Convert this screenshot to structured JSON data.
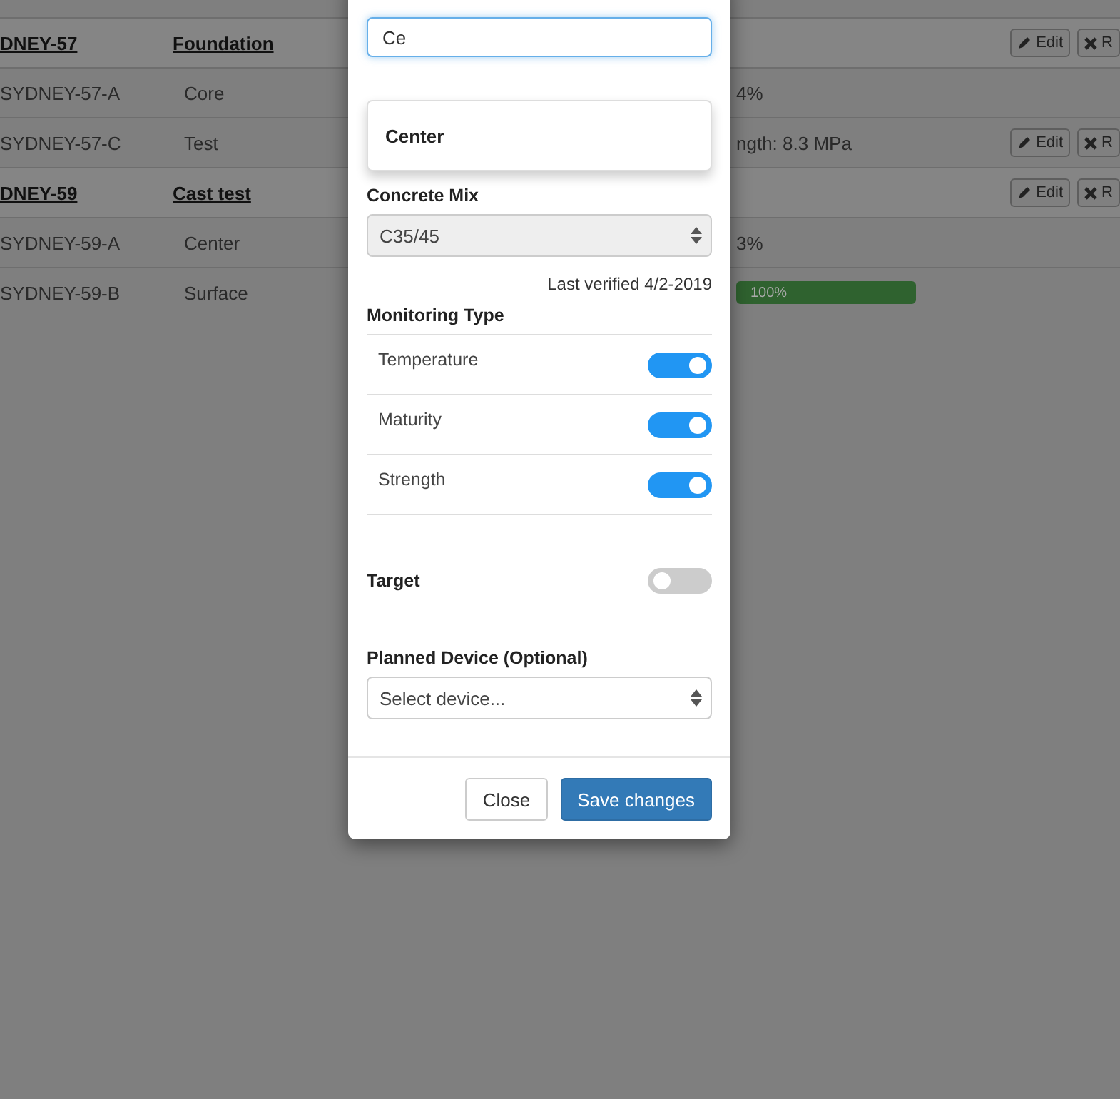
{
  "table": {
    "rows": [
      {
        "kind": "group",
        "column_1": "DNEY-57",
        "column_2": "Foundation",
        "actions": [
          {
            "kind": "edit",
            "label": "Edit"
          },
          {
            "kind": "remove",
            "label": "R"
          }
        ]
      },
      {
        "kind": "item",
        "column_1": "SYDNEY-57-A",
        "column_2": "Core",
        "column_4": "4%"
      },
      {
        "kind": "item",
        "column_1": "SYDNEY-57-C",
        "column_2": "Test",
        "column_4": "ngth: 8.3 MPa",
        "actions": [
          {
            "kind": "edit",
            "label": "Edit"
          },
          {
            "kind": "remove",
            "label": "R"
          }
        ]
      },
      {
        "kind": "group",
        "column_1": "DNEY-59",
        "column_2": "Cast test",
        "actions": [
          {
            "kind": "edit",
            "label": "Edit"
          },
          {
            "kind": "remove",
            "label": "R"
          }
        ]
      },
      {
        "kind": "item",
        "column_1": "SYDNEY-59-A",
        "column_2": "Center",
        "column_4": "3%"
      },
      {
        "kind": "item",
        "column_1": "SYDNEY-59-B",
        "column_2": "Surface",
        "progress": {
          "level": 1,
          "reading": "100%"
        }
      }
    ]
  },
  "modal": {
    "description_field": {
      "value": "Ce",
      "suggestions": [
        "Center"
      ]
    },
    "concrete_mix": {
      "label": "Concrete Mix",
      "value": "C35/45"
    },
    "last_verified": "Last verified 4/2-2019",
    "monitoring_type": {
      "label": "Monitoring Type",
      "options": [
        {
          "label": "Temperature",
          "on": true
        },
        {
          "label": "Maturity",
          "on": true
        },
        {
          "label": "Strength",
          "on": true
        }
      ]
    },
    "target": {
      "label": "Target",
      "on": false
    },
    "planned_device": {
      "label": "Planned Device (Optional)",
      "placeholder": "Select device..."
    },
    "buttons": [
      {
        "kind": "default",
        "label": "Close"
      },
      {
        "kind": "primary",
        "label": "Save changes"
      }
    ]
  }
}
